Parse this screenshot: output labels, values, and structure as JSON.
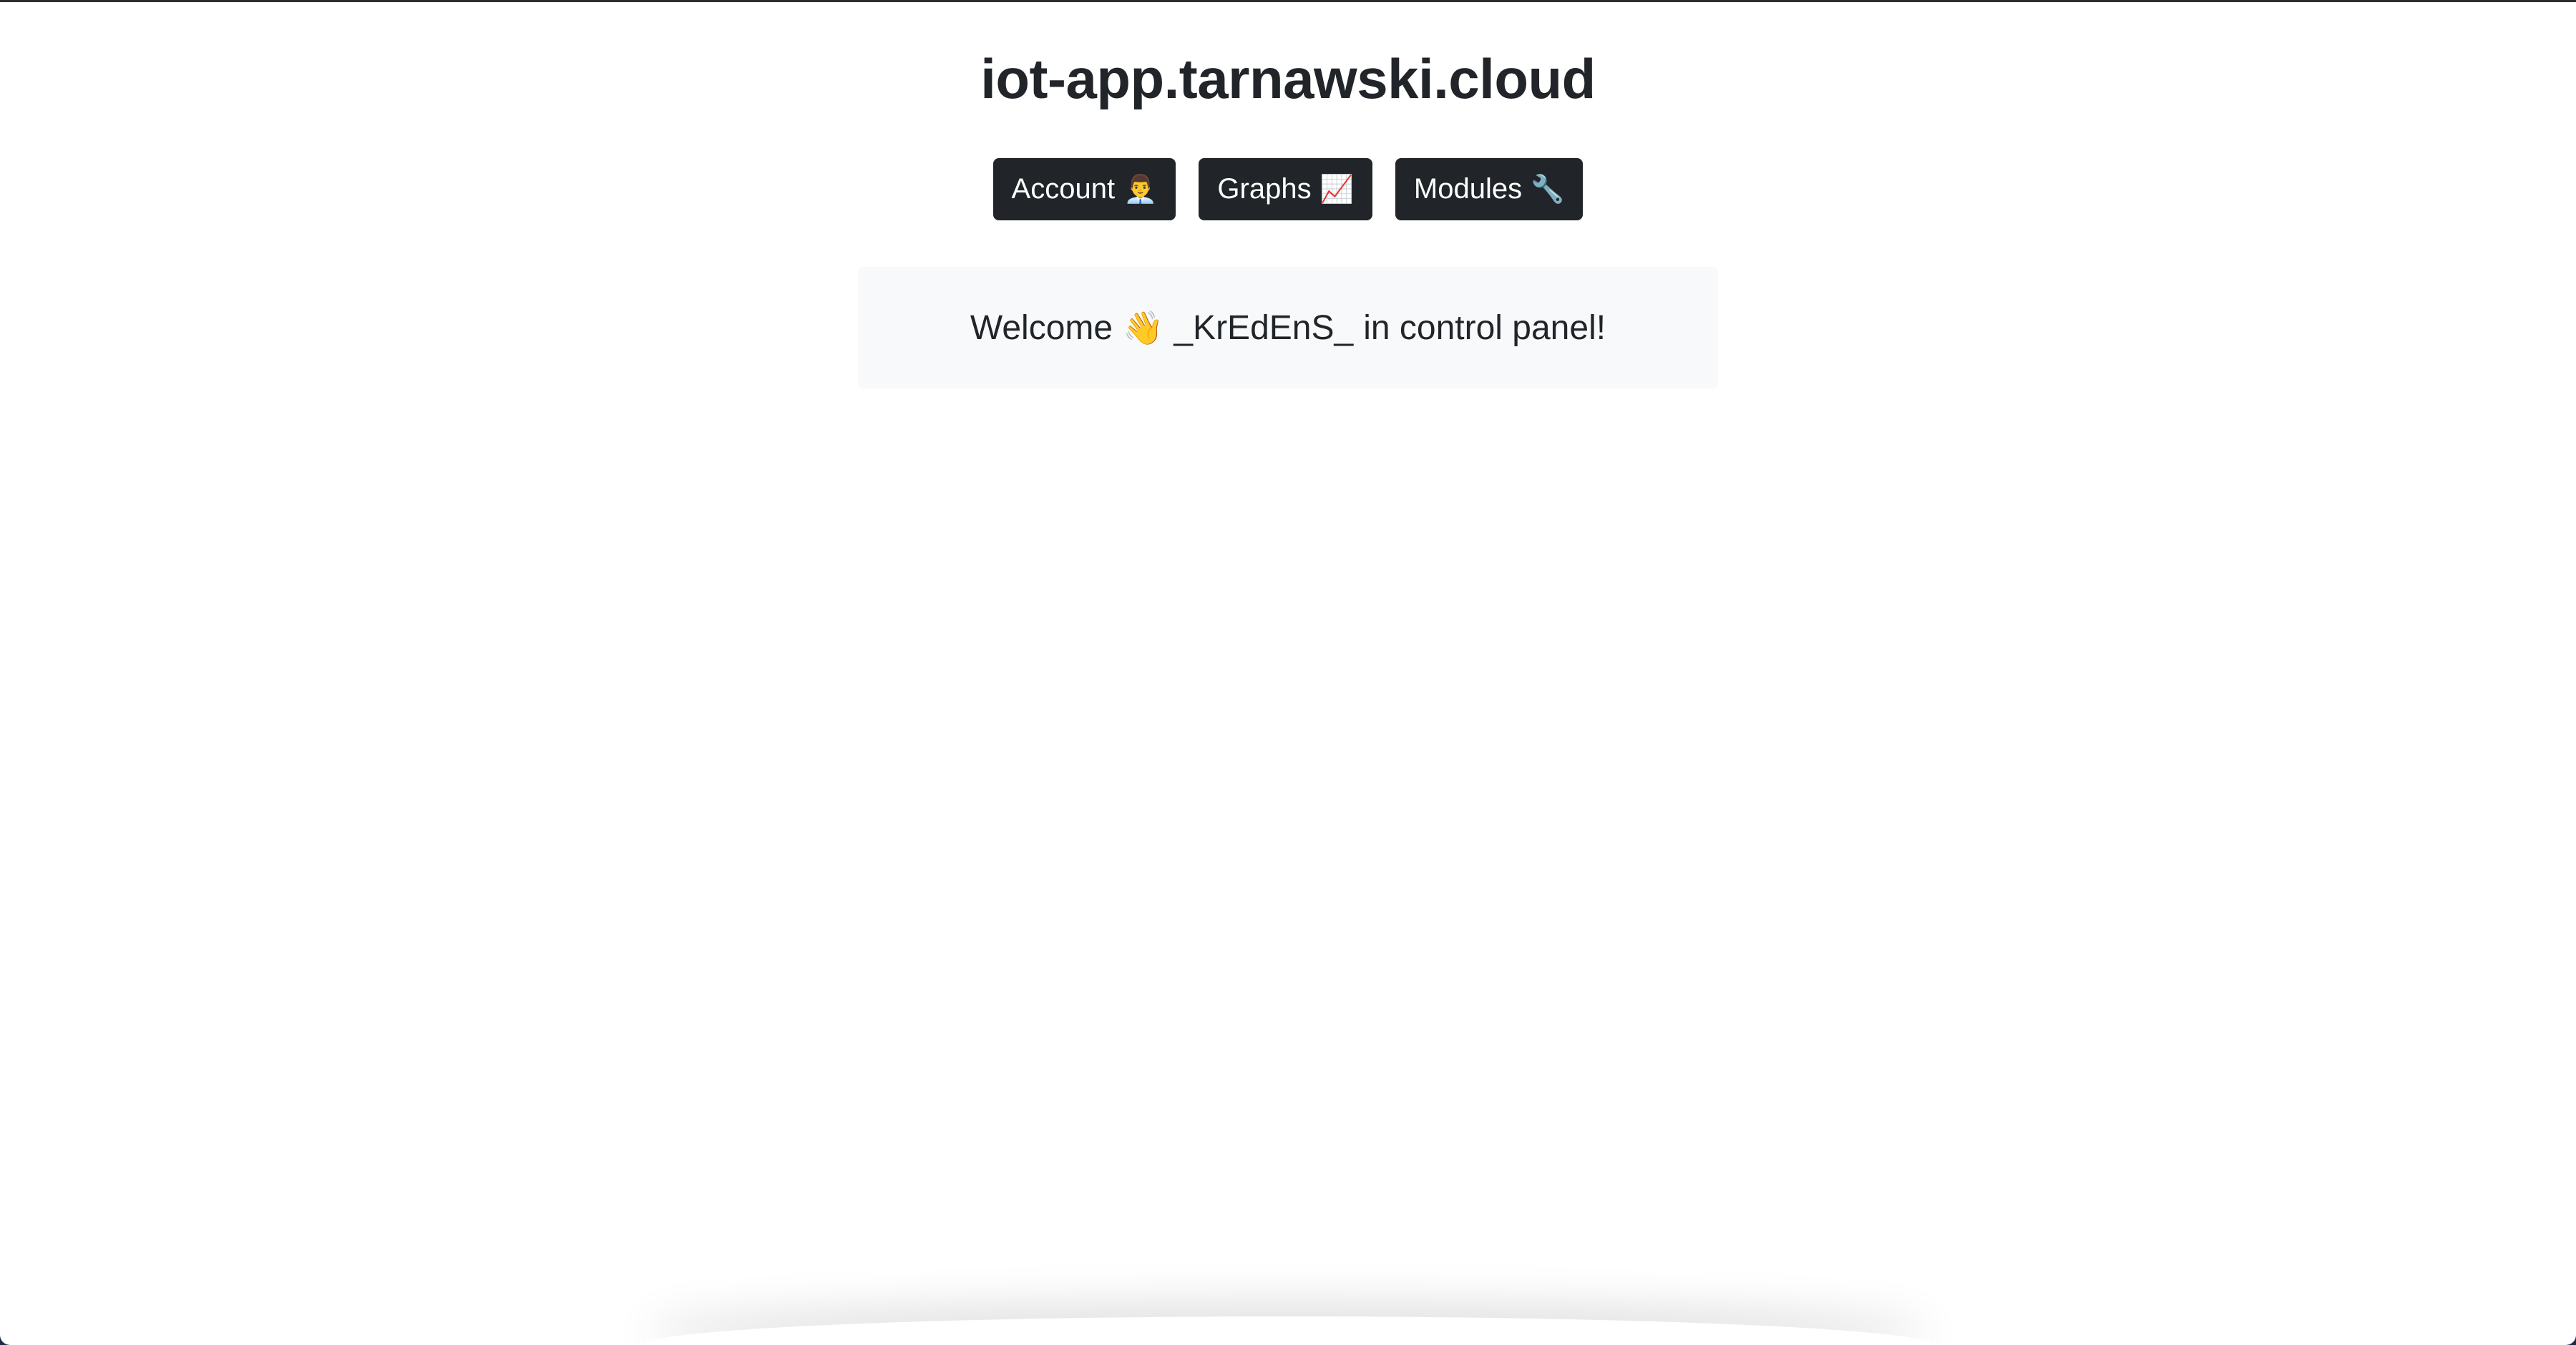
{
  "header": {
    "title": "iot-app.tarnawski.cloud"
  },
  "nav": {
    "items": [
      {
        "label": "Account",
        "icon": "👨‍💼"
      },
      {
        "label": "Graphs",
        "icon": "📈"
      },
      {
        "label": "Modules",
        "icon": "🔧"
      }
    ]
  },
  "welcome": {
    "prefix": "Welcome",
    "icon": "👋",
    "username": "_KrEdEnS_",
    "suffix": "in control panel!"
  },
  "colors": {
    "button_bg": "#212529",
    "card_bg": "#f8f9fa",
    "text": "#212529"
  }
}
